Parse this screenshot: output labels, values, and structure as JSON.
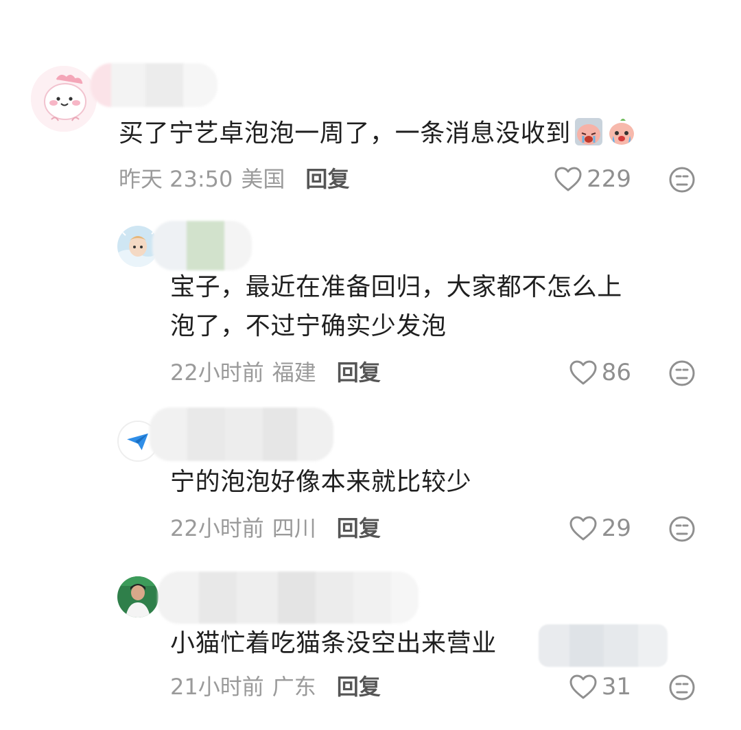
{
  "comments": [
    {
      "text": "买了宁艺卓泡泡一周了，一条消息没收到",
      "emojis": [
        "crying-peach-emoji",
        "teary-peach-emoji"
      ],
      "time": "昨天 23:50",
      "region": "美国",
      "reply_label": "回复",
      "likes": "229",
      "avatar_icon": "pink-dino-avatar"
    },
    {
      "text_lines": [
        "宝子，最近在准备回归，大家都不怎么上",
        "泡了，不过宁确实少发泡"
      ],
      "time": "22小时前",
      "region": "福建",
      "reply_label": "回复",
      "likes": "86",
      "avatar_icon": "anime-avatar"
    },
    {
      "text": "宁的泡泡好像本来就比较少",
      "time": "22小时前",
      "region": "四川",
      "reply_label": "回复",
      "likes": "29",
      "avatar_icon": "paper-plane-avatar"
    },
    {
      "text": "小猫忙着吃猫条没空出来营业",
      "time": "21小时前",
      "region": "广东",
      "reply_label": "回复",
      "likes": "31",
      "avatar_icon": "photo-avatar"
    }
  ],
  "icons": {
    "like": "heart-icon",
    "dislike": "unhappy-face-icon"
  },
  "colors": {
    "text": "#1f1f1f",
    "meta": "#9a9a9a",
    "reply": "#555555"
  }
}
